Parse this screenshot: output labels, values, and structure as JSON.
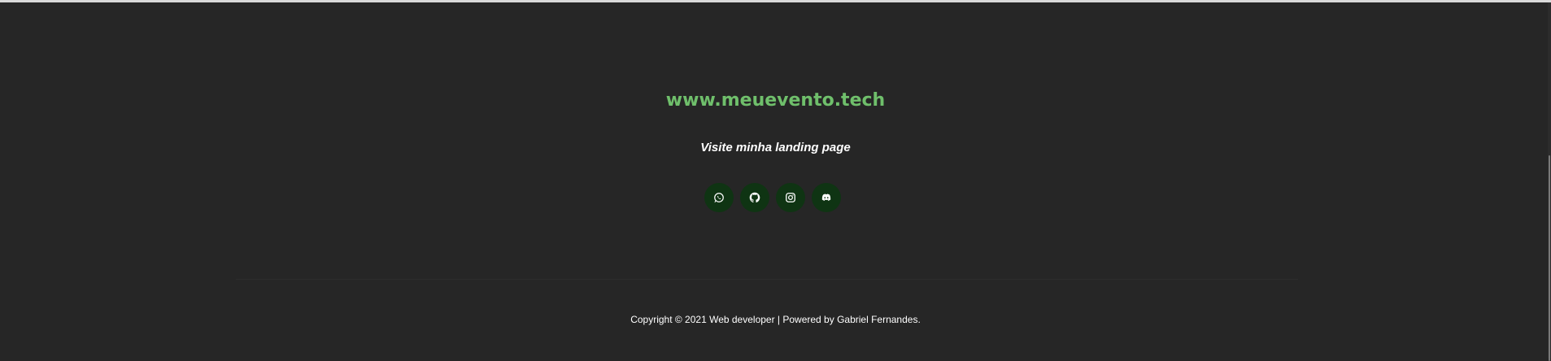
{
  "footer": {
    "site_link": "www.meuevento.tech",
    "tagline": "Visite minha landing page",
    "social": [
      {
        "icon": "whatsapp-icon"
      },
      {
        "icon": "github-icon"
      },
      {
        "icon": "instagram-icon"
      },
      {
        "icon": "discord-icon"
      }
    ],
    "copyright": "Copyright © 2021 Web developer | Powered by Gabriel Fernandes."
  },
  "colors": {
    "background": "#262626",
    "accent": "#6fbf6b",
    "social_bg": "#0f3413",
    "text": "#ffffff"
  }
}
